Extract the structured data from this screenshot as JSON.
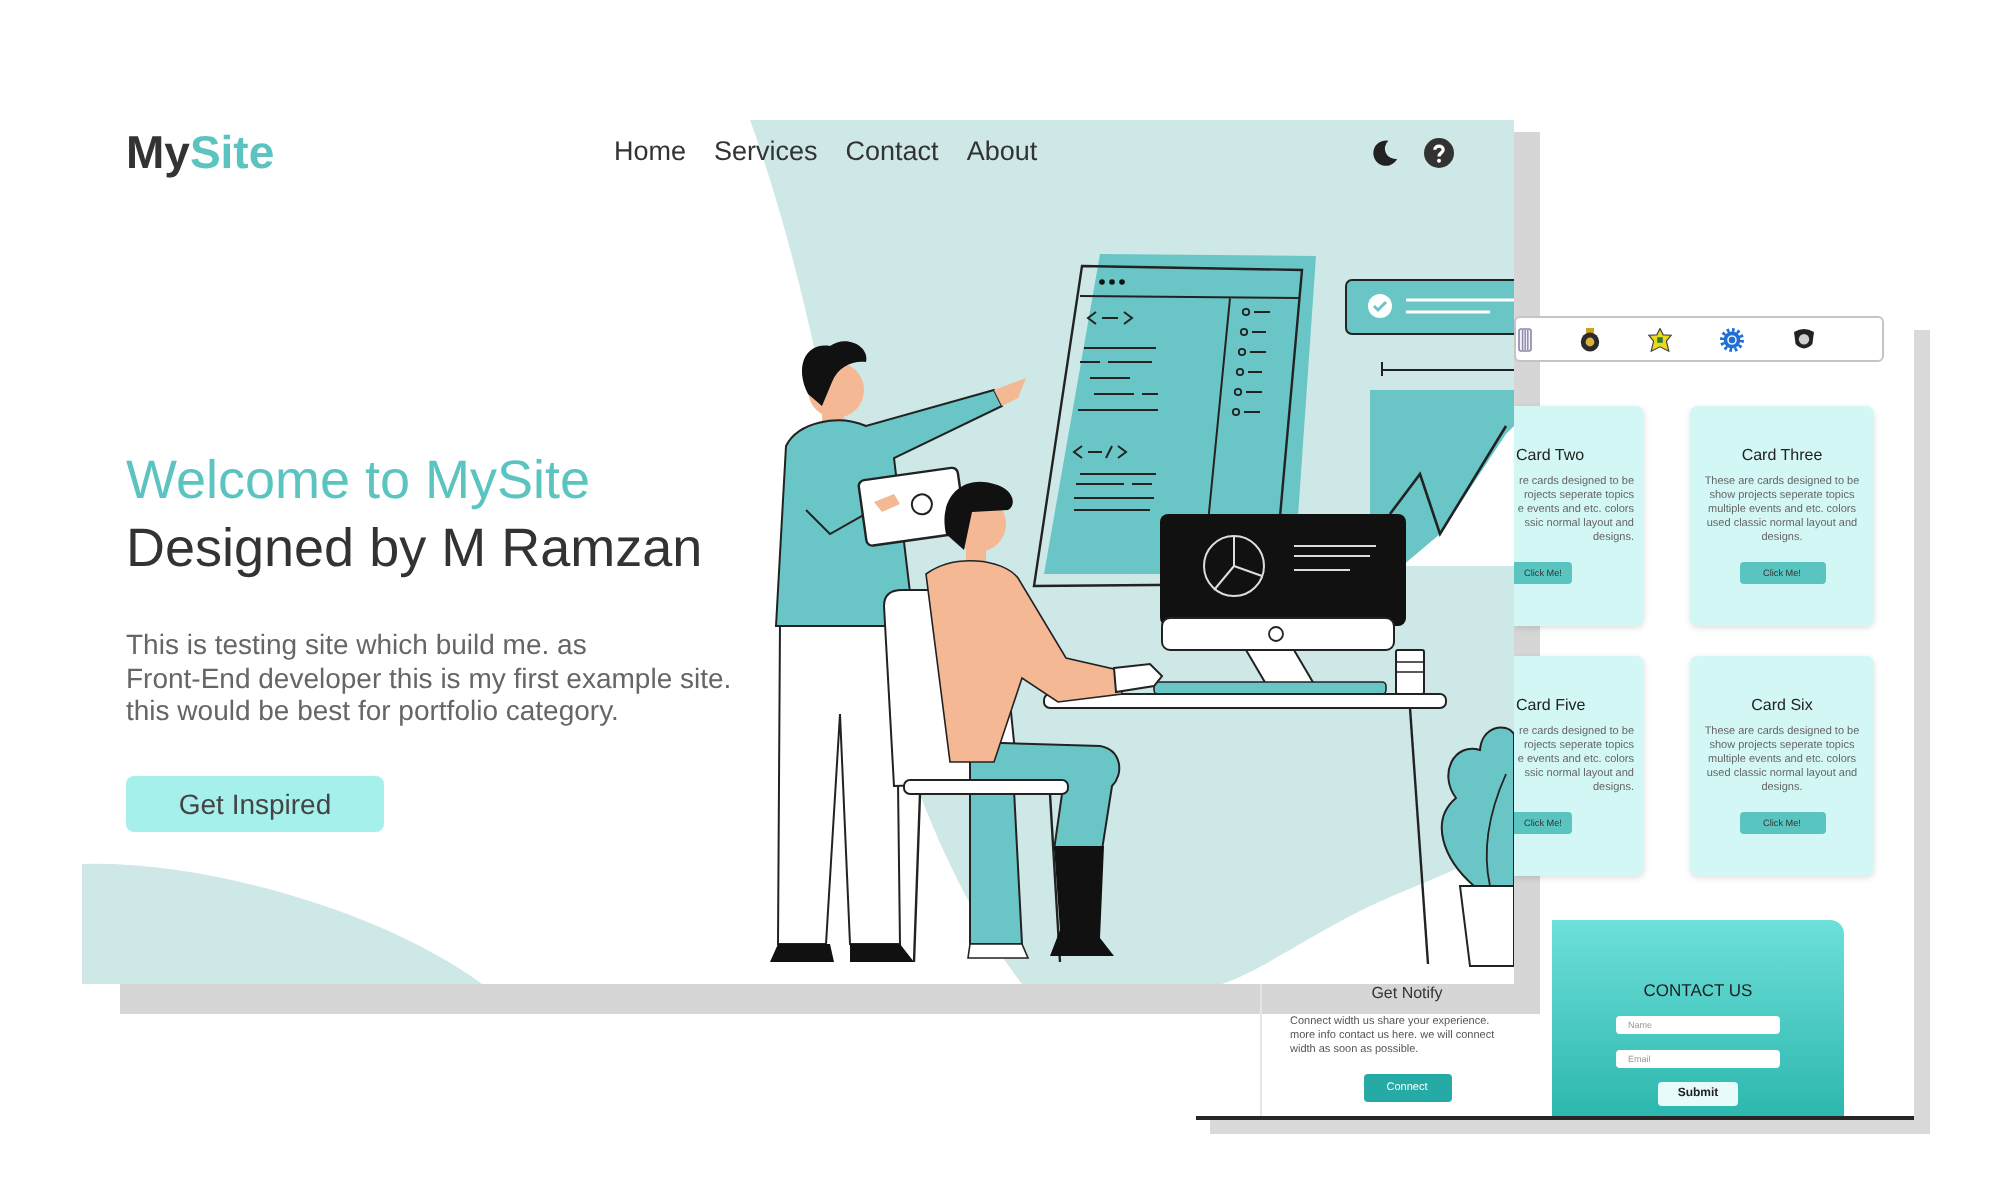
{
  "front_page": {
    "logo": {
      "text": "My",
      "accent_text": "Site"
    },
    "nav": [
      {
        "label": "Home"
      },
      {
        "label": "Services"
      },
      {
        "label": "Contact"
      },
      {
        "label": "About"
      }
    ],
    "actions": [
      {
        "kind": "moon"
      },
      {
        "kind": "help"
      }
    ],
    "hero": {
      "title": "Welcome to MySite",
      "subtitle": "Designed by M Ramzan",
      "description_lines": [
        "This is testing site which build me. as",
        "Front-End developer this is my first example site.",
        "this would be best for portfolio category."
      ],
      "button": "Get Inspired"
    }
  },
  "back_page": {
    "logos": [
      {
        "kind": "striped"
      },
      {
        "kind": "crest"
      },
      {
        "kind": "star"
      },
      {
        "kind": "gear"
      },
      {
        "kind": "shield"
      }
    ],
    "cards": [
      {
        "kind": "partial",
        "title": "Card Two",
        "description_lines": [
          "re cards designed to be",
          "rojects seperate topics",
          "e events and etc. colors",
          "ssic normal layout and",
          "designs."
        ],
        "button": "Click Me!"
      },
      {
        "kind": "full",
        "title": "Card Three",
        "description_lines": [
          "These are cards designed to be",
          "show projects seperate topics",
          "multiple events and etc. colors",
          "used classic normal layout and",
          "designs."
        ],
        "button": "Click Me!"
      },
      {
        "kind": "partial",
        "title": "Card Five",
        "description_lines": [
          "re cards designed to be",
          "rojects seperate topics",
          "e events and etc. colors",
          "ssic normal layout and",
          "designs."
        ],
        "button": "Click Me!"
      },
      {
        "kind": "full",
        "title": "Card Six",
        "description_lines": [
          "These are cards designed to be",
          "show projects seperate topics",
          "multiple events and etc. colors",
          "used classic normal layout and",
          "designs."
        ],
        "button": "Click Me!"
      }
    ],
    "notify": {
      "title": "Get Notify",
      "description_lines": [
        "Connect width us share your experience.",
        "more info contact us here. we will connect",
        "width as soon as possible."
      ],
      "button": "Connect"
    },
    "contact": {
      "title": "CONTACT US",
      "fields": [
        {
          "placeholder": "Name"
        },
        {
          "placeholder": "Email"
        }
      ],
      "button": "Submit"
    }
  }
}
